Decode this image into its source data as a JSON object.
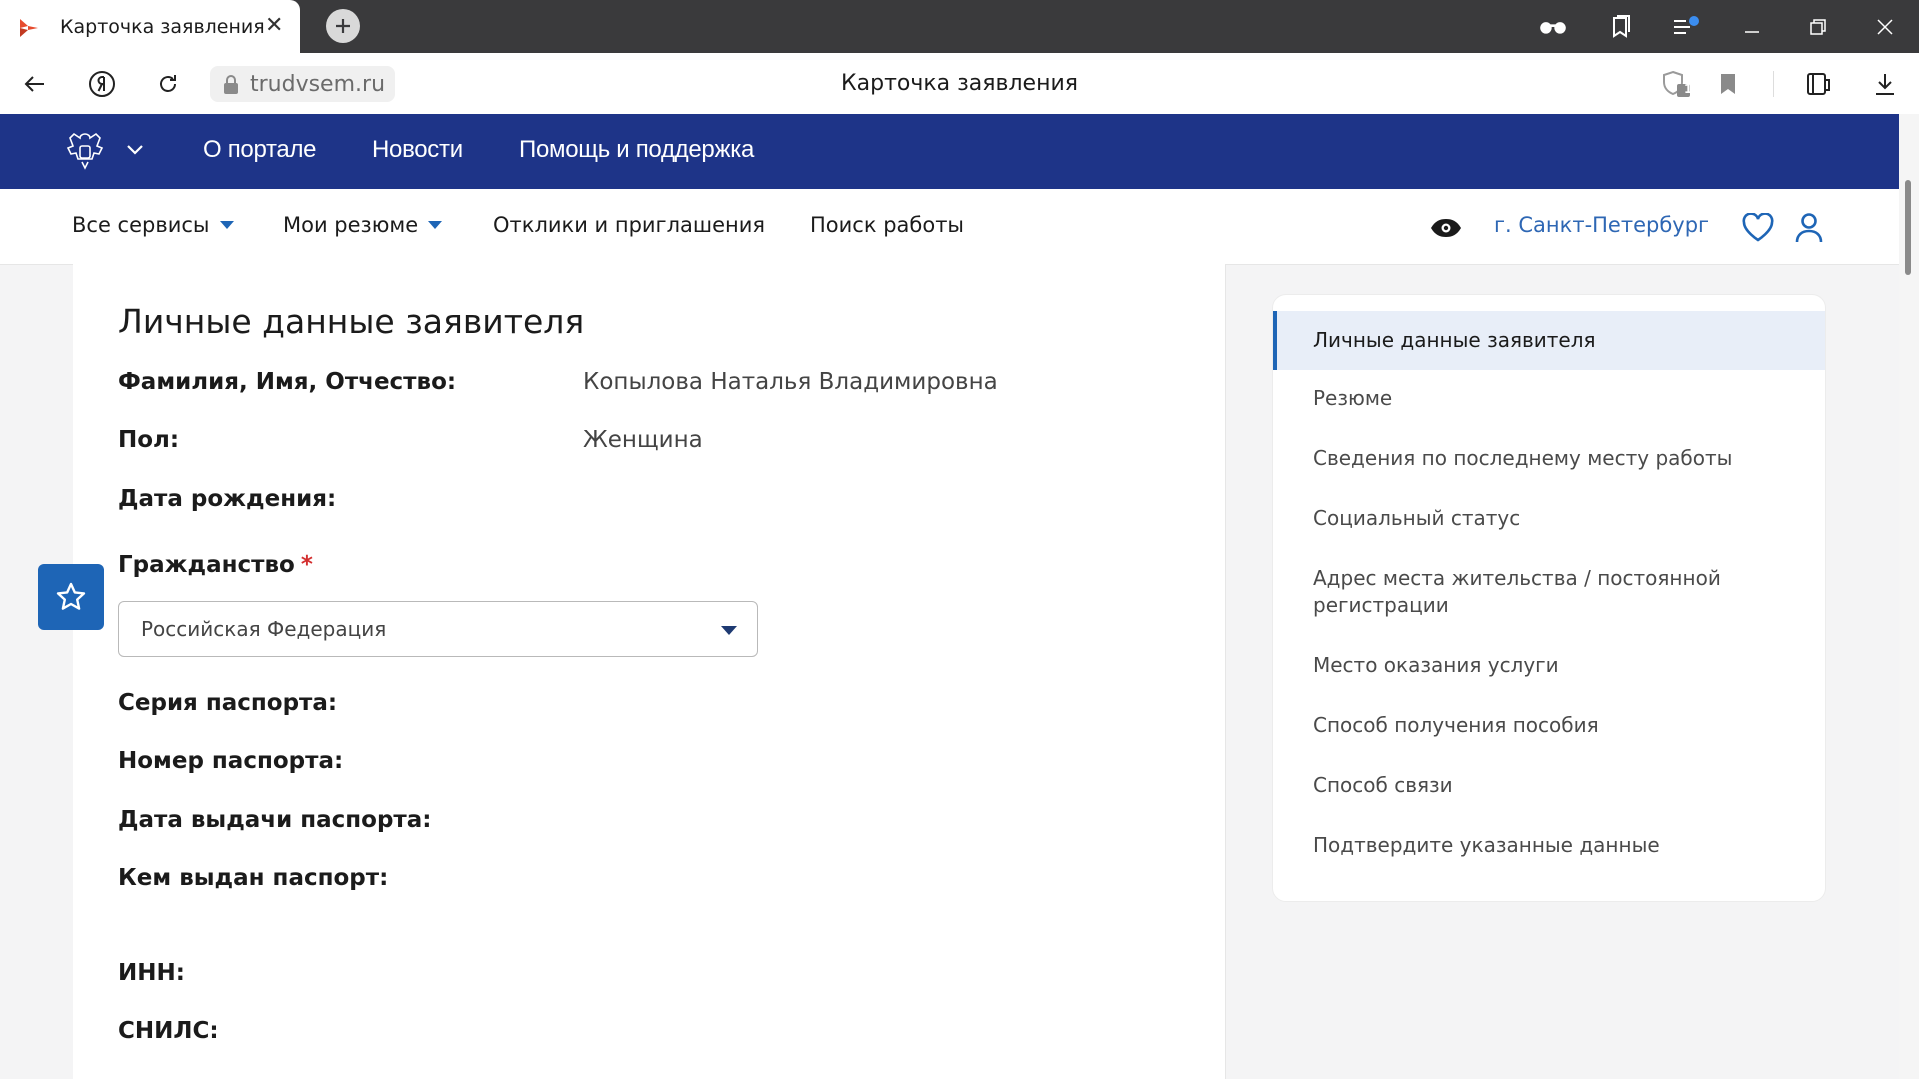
{
  "browser": {
    "tab_title": "Карточка заявления",
    "tab_close": "✕",
    "url": "trudvsem.ru",
    "page_title": "Карточка заявления",
    "extension_badge": "1"
  },
  "site": {
    "topnav": [
      "О портале",
      "Новости",
      "Помощь и поддержка"
    ],
    "nav": {
      "all_services": "Все сервисы",
      "my_resumes": "Мои резюме",
      "responses": "Отклики и приглашения",
      "job_search": "Поиск работы",
      "city": "г. Санкт-Петербург"
    },
    "colors": {
      "header_blue": "#1e3488",
      "accent": "#1e65b6",
      "link": "#2e67b4",
      "required": "#d32f2f"
    }
  },
  "form": {
    "section_title": "Личные данные заявителя",
    "fio_label": "Фамилия, Имя, Отчество:",
    "fio_value": "Копылова Наталья Владимировна",
    "gender_label": "Пол:",
    "gender_value": "Женщина",
    "birth_label": "Дата рождения:",
    "citizenship_label": "Гражданство",
    "required_mark": "*",
    "citizenship_value": "Российская Федерация",
    "passport_series_label": "Серия паспорта:",
    "passport_number_label": "Номер паспорта:",
    "passport_date_label": "Дата выдачи паспорта:",
    "passport_issuer_label": "Кем выдан паспорт:",
    "inn_label": "ИНН:",
    "snils_label": "СНИЛС:"
  },
  "side_menu": {
    "items": [
      "Личные данные заявителя",
      "Резюме",
      "Сведения по последнему месту работы",
      "Социальный статус",
      "Адрес места жительства / постоянной регистрации",
      "Место оказания услуги",
      "Способ получения пособия",
      "Способ связи",
      "Подтвердите указанные данные"
    ],
    "active_index": 0
  }
}
